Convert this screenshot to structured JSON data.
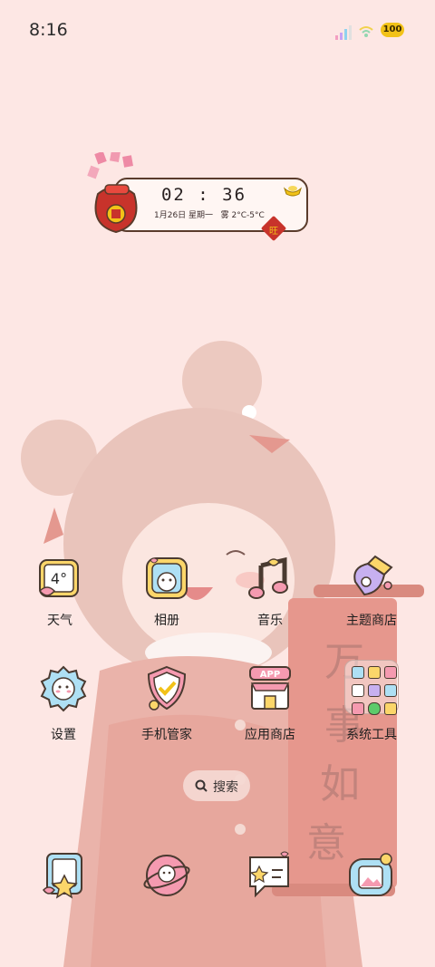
{
  "status_bar": {
    "time": "8:16",
    "battery": "100"
  },
  "clock_widget": {
    "time": "02 : 36",
    "date": "1月26日 星期一",
    "weather": "雾 2°C-5°C",
    "badge": "旺"
  },
  "wallpaper": {
    "banner_text": [
      "万",
      "事",
      "如",
      "意"
    ]
  },
  "apps": [
    {
      "label": "天气",
      "icon": "weather-icon",
      "icon_text": "4°"
    },
    {
      "label": "相册",
      "icon": "gallery-icon"
    },
    {
      "label": "音乐",
      "icon": "music-icon"
    },
    {
      "label": "主题商店",
      "icon": "theme-store-icon"
    },
    {
      "label": "设置",
      "icon": "settings-icon"
    },
    {
      "label": "手机管家",
      "icon": "phone-manager-icon"
    },
    {
      "label": "应用商店",
      "icon": "app-store-icon",
      "icon_text": "APP"
    },
    {
      "label": "系统工具",
      "icon": "system-tools-folder-icon"
    }
  ],
  "search": {
    "label": "搜索"
  },
  "dock": [
    {
      "icon": "phone-icon"
    },
    {
      "icon": "browser-icon"
    },
    {
      "icon": "messages-icon"
    },
    {
      "icon": "camera-icon"
    }
  ],
  "colors": {
    "background": "#fde7e4",
    "accent_red": "#c8332b",
    "outline": "#5a3b2b",
    "gold": "#f2c218"
  }
}
